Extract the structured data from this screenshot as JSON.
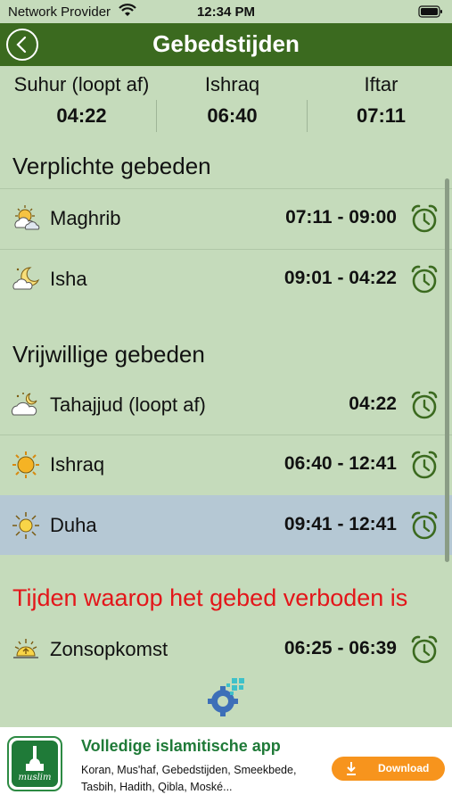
{
  "status_bar": {
    "carrier": "Network Provider",
    "time": "12:34 PM"
  },
  "header": {
    "title": "Gebedstijden"
  },
  "top_times": [
    {
      "label": "Suhur (loopt af)",
      "value": "04:22"
    },
    {
      "label": "Ishraq",
      "value": "06:40"
    },
    {
      "label": "Iftar",
      "value": "07:11"
    }
  ],
  "sections": {
    "mandatory": "Verplichte gebeden",
    "voluntary": "Vrijwillige gebeden",
    "forbidden": "Tijden waarop het gebed verboden is"
  },
  "mandatory_prayers": [
    {
      "name": "Maghrib",
      "time": "07:11 - 09:00",
      "icon": "sunset-cloud-icon"
    },
    {
      "name": "Isha",
      "time": "09:01 - 04:22",
      "icon": "moon-cloud-icon"
    }
  ],
  "voluntary_prayers": [
    {
      "name": "Tahajjud (loopt af)",
      "time": "04:22",
      "icon": "night-cloud-icon"
    },
    {
      "name": "Ishraq",
      "time": "06:40 - 12:41",
      "icon": "sun-icon"
    },
    {
      "name": "Duha",
      "time": "09:41 - 12:41",
      "icon": "bright-sun-icon",
      "highlighted": true
    }
  ],
  "forbidden_times": [
    {
      "name": "Zonsopkomst",
      "time": "06:25 - 06:39",
      "icon": "sunrise-icon"
    }
  ],
  "ad": {
    "logo_text": "muslim",
    "title": "Volledige islamitische app",
    "description": "Koran, Mus'haf, Gebedstijden, Smeekbede, Tasbih, Hadith, Qibla, Moské...",
    "button": "Download"
  },
  "colors": {
    "header": "#3b6a1f",
    "background": "#c5dbbb",
    "highlight": "#b5c8d4",
    "warning": "#e3161a",
    "accent": "#f7941d"
  }
}
